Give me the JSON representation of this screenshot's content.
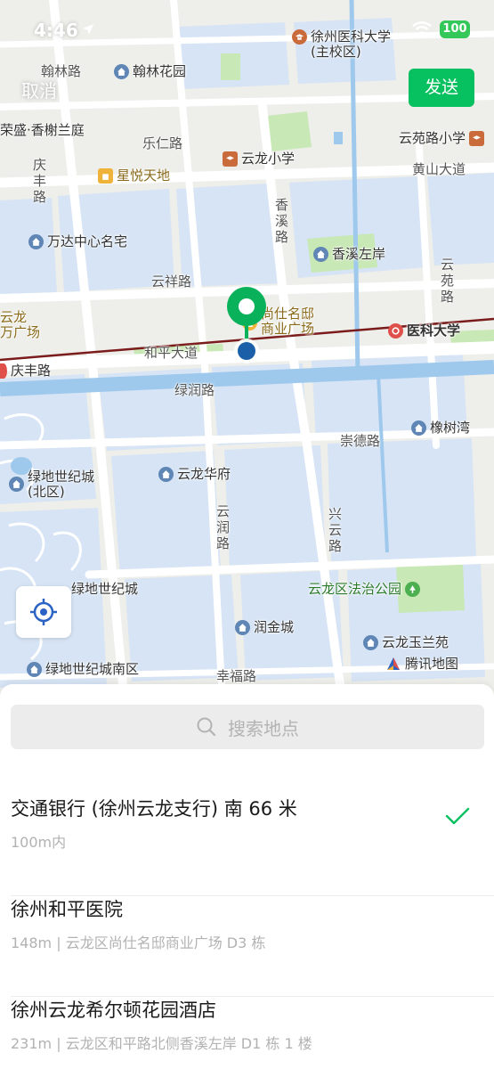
{
  "status_bar": {
    "time": "4:46",
    "battery": "100"
  },
  "header": {
    "cancel_label": "取消",
    "send_label": "发送"
  },
  "map": {
    "labels": {
      "hanlin_road": "翰林路",
      "hanlin_garden": "翰林花园",
      "xmu_main": "徐州医科大学",
      "xmu_main_sub": "(主校区)",
      "rongsheng": "荣盛·香榭兰庭",
      "leren_road": "乐仁路",
      "yunyuan_school": "云苑路小学",
      "qingfeng_road": "庆丰路",
      "xingyue": "星悦天地",
      "yunlong_school": "云龙小学",
      "huangshan": "黄山大道",
      "xiangxi_road": "香溪路",
      "wanda": "万达中心名宅",
      "xiangxi_bank": "香溪左岸",
      "yunyuan_road": "云苑路",
      "yunxiang": "云祥路",
      "shangshi_1": "尚仕名邸",
      "shangshi_2": "商业广场",
      "yunlong_sq_1": "云龙",
      "yunlong_sq_2": "万广场",
      "heping": "和平大道",
      "xmu_station": "医科大学",
      "qingfeng_road2": "庆丰路",
      "lvrun": "绿润路",
      "chongde": "崇德路",
      "xiangshu": "橡树湾",
      "lvdi_north_1": "绿地世纪城",
      "lvdi_north_2": "(北区)",
      "yunlong_hf": "云龙华府",
      "yunrun_road": "云润路",
      "xingyun_road": "兴云路",
      "lvdi_city": "绿地世纪城",
      "law_park": "云龙区法治公园",
      "runjin": "润金城",
      "yulanyuan": "云龙玉兰苑",
      "lvdi_south": "绿地世纪城南区",
      "xingfu": "幸福路",
      "tencent_map": "腾讯地图"
    }
  },
  "search": {
    "placeholder": "搜索地点"
  },
  "places": [
    {
      "name": "交通银行 (徐州云龙支行) 南 66 米",
      "detail": "100m内",
      "selected": true
    },
    {
      "name": "徐州和平医院",
      "detail": "148m | 云龙区尚仕名邸商业广场 D3 栋",
      "selected": false
    },
    {
      "name": "徐州云龙希尔顿花园酒店",
      "detail": "231m | 云龙区和平路北侧香溪左岸 D1 栋 1 楼",
      "selected": false
    }
  ],
  "colors": {
    "accent_green": "#07c160",
    "pin_green": "#09b15b",
    "pin_blue": "#1a5fa8",
    "water": "#9fc9ec",
    "block": "#d6e4f5",
    "park": "#c8e8b5"
  }
}
